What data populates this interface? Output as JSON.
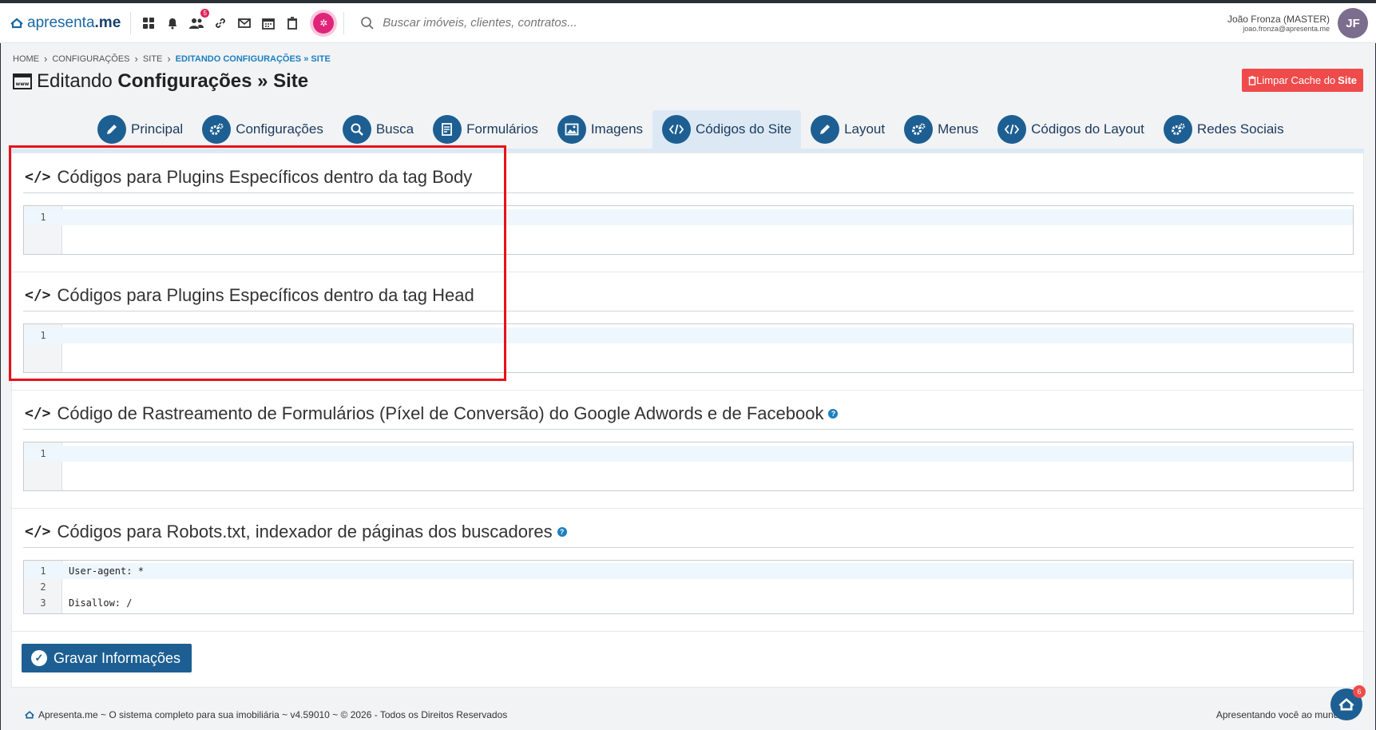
{
  "app": {
    "logo_text_light": "apresenta",
    "logo_text_bold": ".me",
    "notification_count": "5",
    "search_placeholder": "Buscar imóveis, clientes, contratos..."
  },
  "user": {
    "name": "João Fronza (MASTER)",
    "email": "joao.fronza@apresenta.me",
    "initials": "JF"
  },
  "breadcrumb": {
    "items": [
      "HOME",
      "CONFIGURAÇÕES",
      "SITE"
    ],
    "active": "EDITANDO CONFIGURAÇÕES » SITE"
  },
  "page": {
    "title_prefix": "Editando",
    "title_bold": "Configurações » Site",
    "clear_cache_label": "Limpar Cache do",
    "clear_cache_bold": "Site"
  },
  "tabs": [
    {
      "label": "Principal",
      "icon": "pencil-icon"
    },
    {
      "label": "Configurações",
      "icon": "gears-icon"
    },
    {
      "label": "Busca",
      "icon": "search-icon"
    },
    {
      "label": "Formulários",
      "icon": "form-icon"
    },
    {
      "label": "Imagens",
      "icon": "image-icon"
    },
    {
      "label": "Códigos do Site",
      "icon": "code-icon",
      "active": true
    },
    {
      "label": "Layout",
      "icon": "pencil-icon"
    },
    {
      "label": "Menus",
      "icon": "gears-icon"
    },
    {
      "label": "Códigos do Layout",
      "icon": "code-icon"
    },
    {
      "label": "Redes Sociais",
      "icon": "gears-icon"
    }
  ],
  "sections": [
    {
      "title": "Códigos para Plugins Específicos dentro da tag Body",
      "lines": [
        "1"
      ],
      "content": [
        ""
      ]
    },
    {
      "title": "Códigos para Plugins Específicos dentro da tag Head",
      "lines": [
        "1"
      ],
      "content": [
        ""
      ]
    },
    {
      "title": "Código de Rastreamento de Formulários (Píxel de Conversão) do Google Adwords e de Facebook",
      "lines": [
        "1"
      ],
      "content": [
        ""
      ],
      "help": true
    },
    {
      "title": "Códigos para Robots.txt, indexador de páginas dos buscadores",
      "lines": [
        "1",
        "2",
        "3"
      ],
      "content": [
        "User-agent: *",
        "",
        "Disallow: /"
      ],
      "help": true
    }
  ],
  "save_button_label": "Gravar Informações",
  "footer": {
    "left": "Apresenta.me ~ O sistema completo para sua imobiliária ~ v4.59010 ~ © 2026 - Todos os Direitos Reservados",
    "right": "Apresentando você ao mundo",
    "fab_badge": "6"
  },
  "colors": {
    "primary": "#1d5f92",
    "danger": "#ef4b4b",
    "link": "#1b7fc0",
    "annotation": "#e8101a"
  }
}
